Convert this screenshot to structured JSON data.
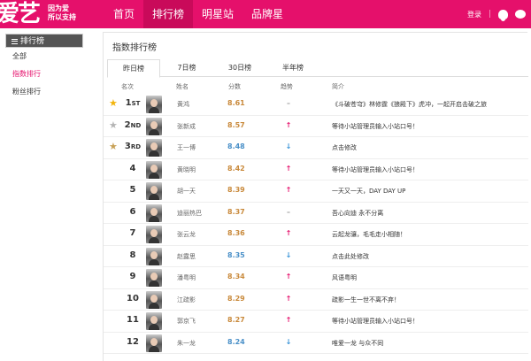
{
  "logo": {
    "big": "爱艺",
    "sub_line1": "因为爱",
    "sub_line2": "所以支持"
  },
  "nav": [
    "首页",
    "排行榜",
    "明星站",
    "品牌星"
  ],
  "nav_active": 1,
  "topright": {
    "login": "登录",
    "sep": "|"
  },
  "sidebar": {
    "title": "排行榜",
    "items": [
      {
        "label": "全部"
      },
      {
        "label": "指数排行"
      },
      {
        "label": "粉丝排行"
      }
    ]
  },
  "panel": {
    "title": "指数排行榜"
  },
  "tabs": [
    "昨日榜",
    "7日榜",
    "30日榜",
    "半年榜"
  ],
  "columns": {
    "rank": "名次",
    "name": "姓名",
    "score": "分数",
    "trend": "趋势",
    "intro": "简介"
  },
  "rows": [
    {
      "rank": "1",
      "suffix": "ST",
      "star": "gold",
      "name": "黄鸿",
      "score": "8.61",
      "trend": "flat",
      "intro": "《斗破苍穹》林修霆《狼殿下》虎冲，一起开启击破之旅"
    },
    {
      "rank": "2",
      "suffix": "ND",
      "star": "silver",
      "name": "张新成",
      "score": "8.57",
      "trend": "up",
      "intro": "等待小站管理员输入小站口号！"
    },
    {
      "rank": "3",
      "suffix": "RD",
      "star": "bronze",
      "name": "王一博",
      "score": "8.48",
      "trend": "down",
      "intro": "点击修改"
    },
    {
      "rank": "4",
      "suffix": "",
      "star": "",
      "name": "黄晓明",
      "score": "8.42",
      "trend": "up",
      "intro": "等待小站管理员输入小站口号！"
    },
    {
      "rank": "5",
      "suffix": "",
      "star": "",
      "name": "胡一天",
      "score": "8.39",
      "trend": "up",
      "intro": "一天又一天，DAY DAY UP"
    },
    {
      "rank": "6",
      "suffix": "",
      "star": "",
      "name": "迪丽热巴",
      "score": "8.37",
      "trend": "flat",
      "intro": "吾心向迪 永不分离"
    },
    {
      "rank": "7",
      "suffix": "",
      "star": "",
      "name": "张云龙",
      "score": "8.36",
      "trend": "up",
      "intro": "云起龙骧，毛毛走小相随！"
    },
    {
      "rank": "8",
      "suffix": "",
      "star": "",
      "name": "赵露思",
      "score": "8.35",
      "trend": "down",
      "intro": "点击此处修改"
    },
    {
      "rank": "9",
      "suffix": "",
      "star": "",
      "name": "潘粤明",
      "score": "8.34",
      "trend": "up",
      "intro": "风语粤明"
    },
    {
      "rank": "10",
      "suffix": "",
      "star": "",
      "name": "江疏影",
      "score": "8.29",
      "trend": "up",
      "intro": "疏影一生一世不离不弃！"
    },
    {
      "rank": "11",
      "suffix": "",
      "star": "",
      "name": "郭京飞",
      "score": "8.27",
      "trend": "up",
      "intro": "等待小站管理员输入小站口号！"
    },
    {
      "rank": "12",
      "suffix": "",
      "star": "",
      "name": "朱一龙",
      "score": "8.24",
      "trend": "down",
      "intro": "唯爱一龙 与众不同"
    }
  ],
  "colors": {
    "brand": "#e5106b",
    "score_orange": "#c98a3c",
    "score_blue": "#4a90c8",
    "up": "#e5106b",
    "down": "#2f8fd6"
  }
}
